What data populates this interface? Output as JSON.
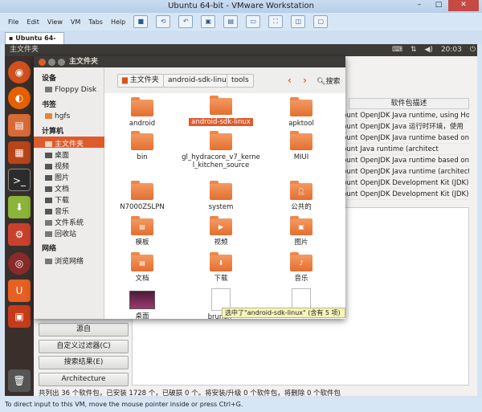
{
  "vmware": {
    "title": "Ubuntu 64-bit - VMware Workstation",
    "menu": [
      "File",
      "Edit",
      "View",
      "VM",
      "Tabs",
      "Help"
    ],
    "tab_label": "Ubuntu 64-bit",
    "status_bar": "To direct input to this VM, move the mouse pointer inside or press Ctrl+G."
  },
  "ubuntu_panel": {
    "app_title": "主文件夹",
    "clock": "20:03"
  },
  "file_manager": {
    "title": "主文件夹",
    "sidebar": {
      "devices_header": "设备",
      "devices": [
        "Floppy Disk"
      ],
      "bookmarks_header": "书签",
      "bookmarks": [
        "hgfs"
      ],
      "computer_header": "计算机",
      "computer": [
        "主文件夹",
        "桌面",
        "视频",
        "图片",
        "文档",
        "下载",
        "音乐",
        "文件系统",
        "回收站"
      ],
      "network_header": "网络",
      "network": [
        "浏览网络"
      ]
    },
    "breadcrumb": [
      "主文件夹",
      "android-sdk-linux",
      "tools"
    ],
    "search_label": "搜索",
    "items": [
      "android",
      "android-sdk-linux",
      "apktool",
      "bin",
      "gl_hydracore_v7_kernel_kitchen_source",
      "MIUI",
      "N7000ZSLPN",
      "system",
      "公共的",
      "模板",
      "视频",
      "图片",
      "文档",
      "下载",
      "音乐",
      "桌面",
      "brunch-"
    ],
    "selection_tooltip": "选中了\"android-sdk-linux\" (含有 5 项)"
  },
  "background_app": {
    "column_header": "软件包描述",
    "rows": [
      "bunt OpenJDK Java runtime, using Hot",
      "bunt OpenJDK Java 运行时环境，使用",
      "bunt OpenJDK Java runtime based on",
      "bunt Java runtime (architect",
      "bunt OpenJDK Java runtime based on",
      "bunt OpenJDK Java runtime (architect",
      "bunt OpenJDK Development Kit (JDK)",
      "bunt OpenJDK Development Kit (JDK)"
    ],
    "buttons": [
      "源自",
      "自定义过滤器(C)",
      "搜索结果(E)",
      "Architecture"
    ],
    "status": "共列出 36 个软件包，已安装 1728 个，已破损 0 个。将安装/升级 0 个软件包，将删除 0 个软件包"
  }
}
